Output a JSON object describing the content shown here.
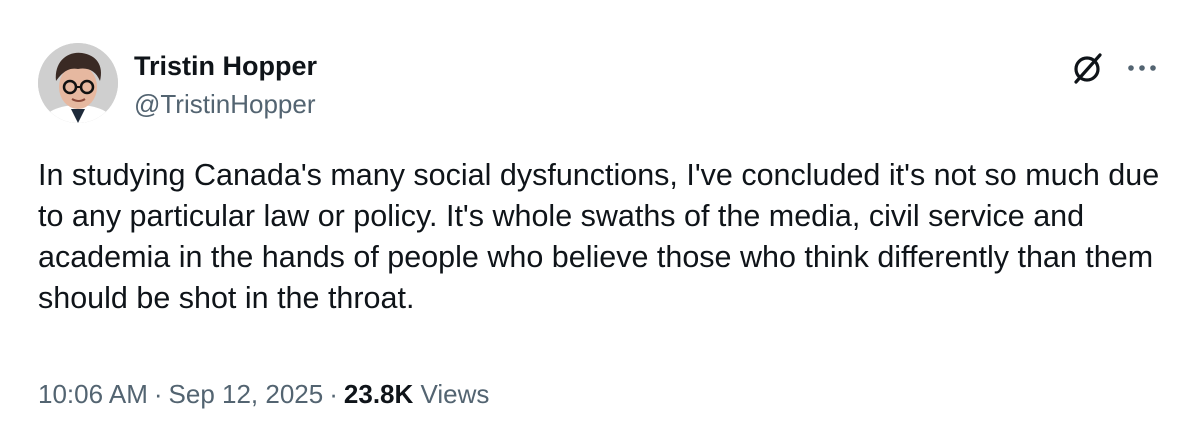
{
  "author": {
    "display_name": "Tristin Hopper",
    "handle": "@TristinHopper"
  },
  "icons": {
    "avatar": "profile-photo",
    "grok": "grok-icon",
    "more": "more-options-icon"
  },
  "tweet": {
    "text": "In studying Canada's many social dysfunctions, I've concluded it's not so much due to any particular law or policy. It's whole swaths of the media, civil service and academia in the hands of people who believe those who think differently than them should be shot in the throat."
  },
  "meta": {
    "time": "10:06 AM",
    "separator": "·",
    "date": "Sep 12, 2025",
    "views_count": "23.8K",
    "views_label": "Views"
  },
  "colors": {
    "text_primary": "#0f1419",
    "text_secondary": "#536471",
    "background": "#ffffff"
  }
}
